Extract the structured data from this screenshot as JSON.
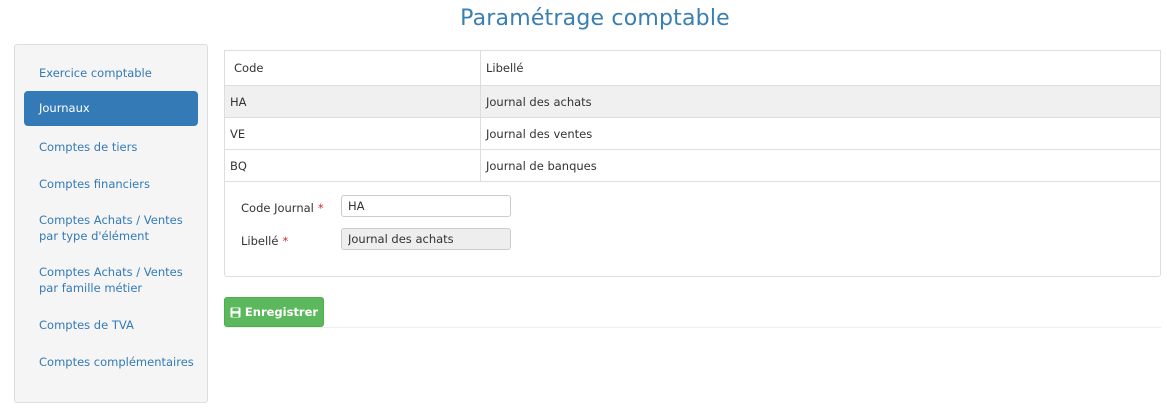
{
  "title": "Paramétrage comptable",
  "sidebar": {
    "items": [
      {
        "label": "Exercice comptable",
        "active": false
      },
      {
        "label": "Journaux",
        "active": true
      },
      {
        "label": "Comptes de tiers",
        "active": false
      },
      {
        "label": "Comptes financiers",
        "active": false
      },
      {
        "label": "Comptes Achats / Ventes par type d'élément",
        "active": false
      },
      {
        "label": "Comptes Achats / Ventes par famille métier",
        "active": false
      },
      {
        "label": "Comptes de TVA",
        "active": false
      },
      {
        "label": "Comptes complémentaires",
        "active": false
      }
    ]
  },
  "table": {
    "headers": {
      "code": "Code",
      "libelle": "Libellé"
    },
    "rows": [
      {
        "code": "HA",
        "libelle": "Journal des achats",
        "selected": true
      },
      {
        "code": "VE",
        "libelle": "Journal des ventes",
        "selected": false
      },
      {
        "code": "BQ",
        "libelle": "Journal de banques",
        "selected": false
      }
    ]
  },
  "form": {
    "code_label": "Code Journal",
    "code_value": "HA",
    "libelle_label": "Libellé",
    "libelle_value": "Journal des achats",
    "required_mark": "*"
  },
  "actions": {
    "save_label": "Enregistrer",
    "save_icon": "floppy-disk-icon"
  },
  "colors": {
    "accent": "#337ab7",
    "title": "#3a7fb4",
    "save": "#5cb85c",
    "required": "#c9302c"
  }
}
